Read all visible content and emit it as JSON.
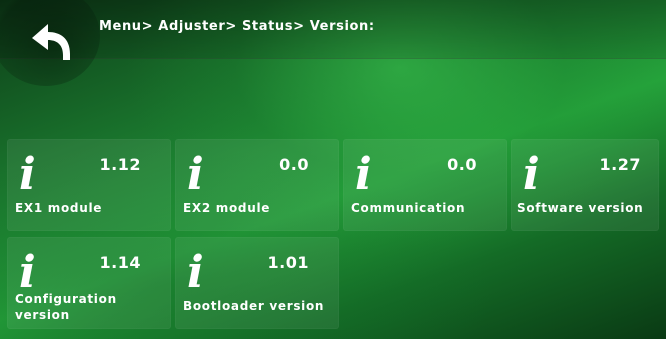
{
  "header": {
    "breadcrumb": "Menu> Adjuster> Status> Version:",
    "back_icon": "back-arrow-icon"
  },
  "tiles": [
    {
      "icon": "i",
      "value": "1.12",
      "label": "EX1 module"
    },
    {
      "icon": "i",
      "value": "0.0",
      "label": "EX2 module"
    },
    {
      "icon": "i",
      "value": "0.0",
      "label": "Communication"
    },
    {
      "icon": "i",
      "value": "1.27",
      "label": "Software version"
    },
    {
      "icon": "i",
      "value": "1.14",
      "label": "Configuration version"
    },
    {
      "icon": "i",
      "value": "1.01",
      "label": "Bootloader version"
    }
  ],
  "colors": {
    "background": "#1b7a2f",
    "text": "#ffffff"
  }
}
